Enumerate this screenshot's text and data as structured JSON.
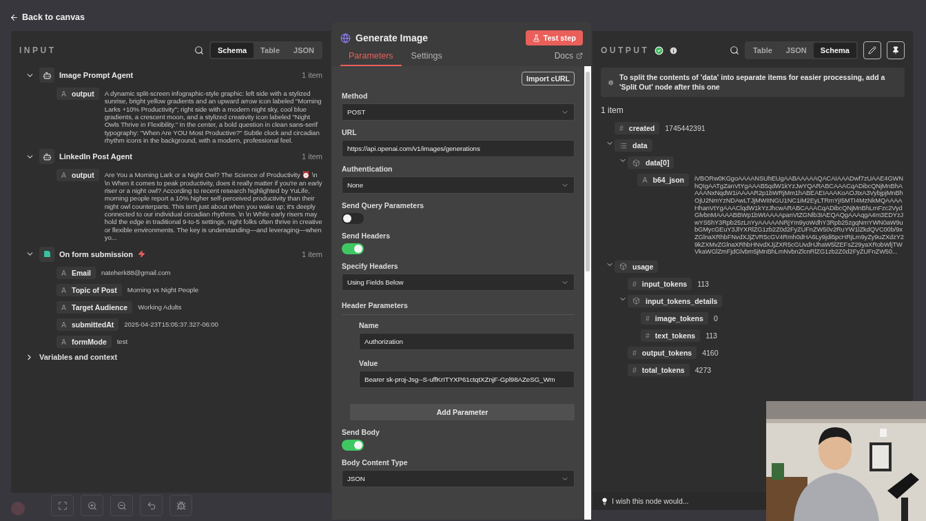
{
  "back_link": "Back to canvas",
  "input": {
    "title": "INPUT",
    "view_tabs": [
      {
        "label": "Schema",
        "selected": true
      },
      {
        "label": "Table",
        "selected": false
      },
      {
        "label": "JSON",
        "selected": false
      }
    ],
    "nodes": [
      {
        "kind": "agent",
        "name": "Image Prompt Agent",
        "count": "1 item",
        "expanded": true,
        "fields": [
          {
            "mark": "A",
            "key": "output",
            "value": "A dynamic split-screen infographic-style graphic: left side with a stylized sunrise, bright yellow gradients and an upward arrow icon labeled \"Morning Larks +10% Productivity\"; right side with a modern night sky, cool blue gradients, a crescent moon, and a stylized creativity icon labeled \"Night Owls Thrive in Flexibility.\" In the center, a bold question in clean sans-serif typography: \"When Are YOU Most Productive?\" Subtle clock and circadian rhythm icons in the background, with a modern, professional feel."
          }
        ]
      },
      {
        "kind": "agent",
        "name": "LinkedIn Post Agent",
        "count": "1 item",
        "expanded": true,
        "fields": [
          {
            "mark": "A",
            "key": "output",
            "value": "Are You a Morning Lark or a Night Owl? The Science of Productivity ⏰ \\n \\n When it comes to peak productivity, does it really matter if you're an early riser or a night owl? According to recent research highlighted by YuLife, morning people report a 10% higher self-perceived productivity than their night owl counterparts. This isn't just about when you wake up; it's deeply connected to our individual circadian rhythms. \\n \\n While early risers may hold the edge in traditional 9-to-5 settings, night folks often thrive in creative or flexible environments. The key is understanding—and leveraging—when yo..."
          }
        ]
      },
      {
        "kind": "trigger",
        "name": "On form submission",
        "count": "1 item",
        "expanded": true,
        "fields": [
          {
            "mark": "A",
            "key": "Email",
            "value": "nateherk88@gmail.com"
          },
          {
            "mark": "A",
            "key": "Topic of Post",
            "value": "Morning vs Night People"
          },
          {
            "mark": "A",
            "key": "Target Audience",
            "value": "Working Adults"
          },
          {
            "mark": "A",
            "key": "submittedAt",
            "value": "2025-04-23T15:05:37.327-06:00"
          },
          {
            "mark": "A",
            "key": "formMode",
            "value": "test"
          }
        ]
      }
    ],
    "variables": {
      "label": "Variables and context",
      "expanded": false
    }
  },
  "node": {
    "title": "Generate Image",
    "test_button": "Test step",
    "tabs": [
      {
        "label": "Parameters",
        "selected": true
      },
      {
        "label": "Settings",
        "selected": false
      }
    ],
    "docs": "Docs",
    "import_button": "Import cURL",
    "params": [
      {
        "kind": "select",
        "label": "Method",
        "value": "POST"
      },
      {
        "kind": "input",
        "label": "URL",
        "value": "https://api.openai.com/v1/images/generations"
      },
      {
        "kind": "select",
        "label": "Authentication",
        "value": "None"
      },
      {
        "kind": "toggle",
        "label": "Send Query Parameters",
        "on": false
      },
      {
        "kind": "toggle",
        "label": "Send Headers",
        "on": true
      },
      {
        "kind": "select",
        "label": "Specify Headers",
        "value": "Using Fields Below"
      },
      {
        "kind": "group",
        "label": "Header Parameters",
        "children": [
          {
            "kind": "input",
            "label": "Name",
            "value": "Authorization"
          },
          {
            "kind": "input",
            "label": "Value",
            "value": "Bearer sk-proj-Jsg--S-uffKrITYXP61ctqtXZnjF-Gpl98AZeSG_Wm"
          }
        ],
        "button": "Add Parameter"
      },
      {
        "kind": "toggle",
        "label": "Send Body",
        "on": true
      },
      {
        "kind": "select",
        "label": "Body Content Type",
        "value": "JSON"
      }
    ]
  },
  "output": {
    "title": "OUTPUT",
    "view_tabs": [
      {
        "label": "Table",
        "selected": false
      },
      {
        "label": "JSON",
        "selected": false
      },
      {
        "label": "Schema",
        "selected": true
      }
    ],
    "notice": "To split the contents of 'data' into separate items for easier processing, add a 'Split Out' node after this one",
    "count": "1 item",
    "tree": [
      {
        "kind": "number",
        "mark": "#",
        "key": "created",
        "value": "1745442391"
      },
      {
        "kind": "array",
        "key": "data",
        "expanded": true,
        "children": [
          {
            "kind": "object",
            "key": "data[0]",
            "expanded": true,
            "children": [
              {
                "kind": "string",
                "mark": "A",
                "key": "b64_json",
                "value": "iVBORw0KGgoAAAANSUhEUgAABAAAAAQACAIAAADwf7zUAAE4GWNhQIgAATgZanVtYgAAAB5qdW1kYzJwYQARABCAAACqADibcQNjMnBhAAAANxNqdW1iAAAAR2p1bWRjMm1hABEAEIAAAKoAOJtxA3VybjpjMnBhOjU2NmYzNDAwLTJjMWItNGU1NC1iM2EyLTRmYjI5MTI4MzNkMQAAAAHhanVtYgAAAClqdW1kYzJhcwARABCAAACqADibcQNjMnBhLmFzc2VydGlvbnMAAAABBWp1bWIAAAApanVtZGNlb3IAEQAQgAAAqgA4m3EDYzJwYS5hY3Rpb25zLnYyAAAAANRjYm9yoWdhY3Rpb25zgqNmYWN0aW9ubGMycGEuY3JlYXRlZG1zb2Z0d2FyZUFnZW50v2RuYW1lZkdQVC00b/9xZGlnaXRhbFNvdXJjZVR5cGV4Rmh0dHA6Ly9jdi5pcHRjLm9yZy9uZXdzY29kZXMvZGlnaXRhbHNvdXJjZXR5cGUvdHJhaW5lZEFsZ29yaXRobWljTWVkaWGlZmFjdGlvbm5jMnBhLmNvbnZlcnRlZG1zb2Z0d2FyZUFnZW50..."
              }
            ]
          }
        ]
      },
      {
        "kind": "object",
        "key": "usage",
        "expanded": true,
        "children": [
          {
            "kind": "number",
            "mark": "#",
            "key": "input_tokens",
            "value": "113"
          },
          {
            "kind": "object",
            "key": "input_tokens_details",
            "expanded": true,
            "children": [
              {
                "kind": "number",
                "mark": "#",
                "key": "image_tokens",
                "value": "0"
              },
              {
                "kind": "number",
                "mark": "#",
                "key": "text_tokens",
                "value": "113"
              }
            ]
          },
          {
            "kind": "number",
            "mark": "#",
            "key": "output_tokens",
            "value": "4160"
          },
          {
            "kind": "number",
            "mark": "#",
            "key": "total_tokens",
            "value": "4273"
          }
        ]
      }
    ],
    "hint": "I wish this node would..."
  }
}
